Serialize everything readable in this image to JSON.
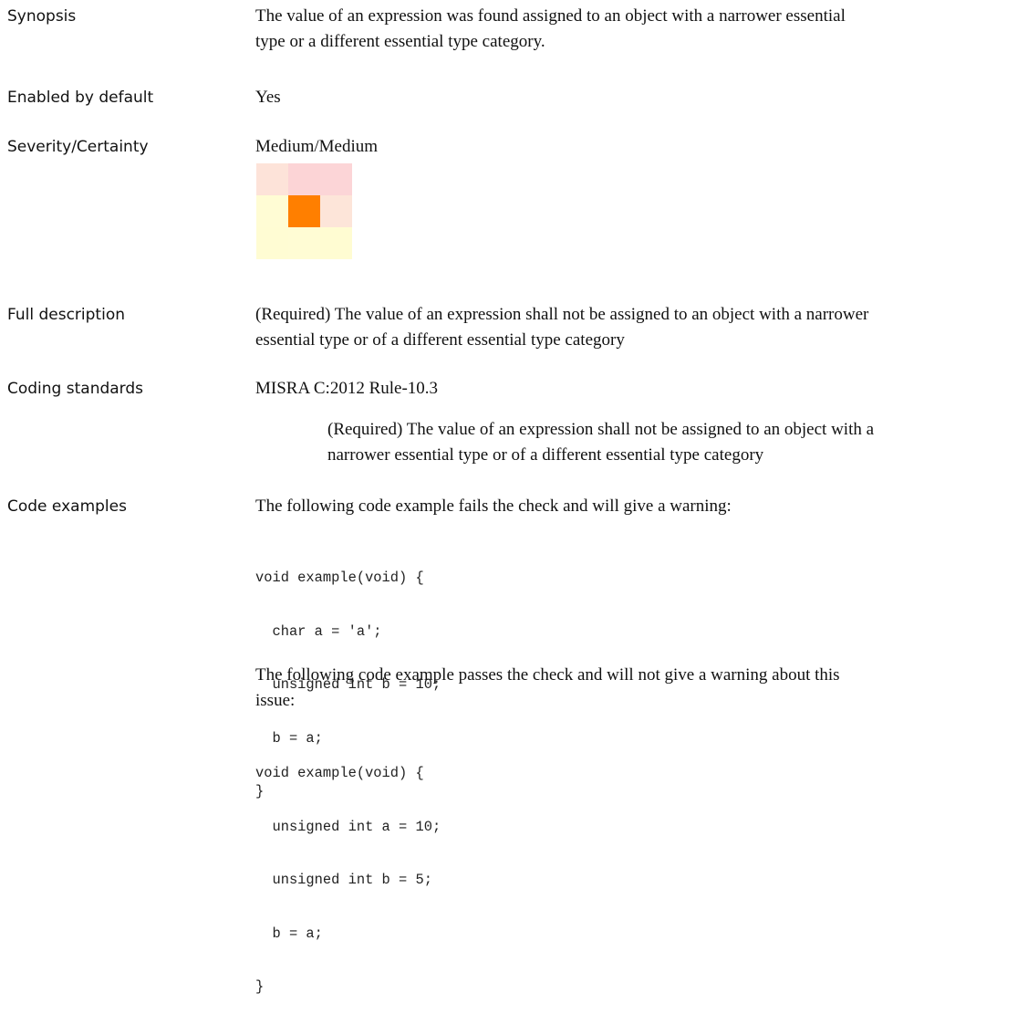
{
  "synopsis": {
    "label": "Synopsis",
    "line1": "The value of an expression was found assigned to an object with a narrower essential",
    "line2": "type or a different essential type category."
  },
  "enabled": {
    "label": "Enabled by default",
    "value": "Yes"
  },
  "severity": {
    "label": "Severity/Certainty",
    "value": "Medium/Medium",
    "matrix_colors": [
      [
        "#fde3d9",
        "#fcd4d6",
        "#fcd5d7"
      ],
      [
        "#fffcd4",
        "#ff7f00",
        "#fde5d9"
      ],
      [
        "#fffcd3",
        "#fffcd4",
        "#fffcd2"
      ]
    ]
  },
  "full_description": {
    "label": "Full description",
    "line1": "(Required) The value of an expression shall not be assigned to an object with a narrower",
    "line2": "essential type or of a different essential type category"
  },
  "coding_standards": {
    "label": "Coding standards",
    "standard": "MISRA C:2012 Rule-10.3",
    "desc_line1": "(Required) The value of an expression shall not be assigned to an object with a",
    "desc_line2": "narrower essential type or of a different essential type category"
  },
  "code_examples": {
    "label": "Code examples",
    "fail_intro": "The following code example fails the check and will give a warning:",
    "fail_code": [
      "void example(void) {",
      "  char a = 'a';",
      "  unsigned int b = 10;",
      "  b = a;",
      "}"
    ],
    "pass_intro_line1": "The following code example passes the check and will not give a warning about this",
    "pass_intro_line2": "issue:",
    "pass_code": [
      "void example(void) {",
      "  unsigned int a = 10;",
      "  unsigned int b = 5;",
      "  b = a;",
      "}"
    ]
  }
}
